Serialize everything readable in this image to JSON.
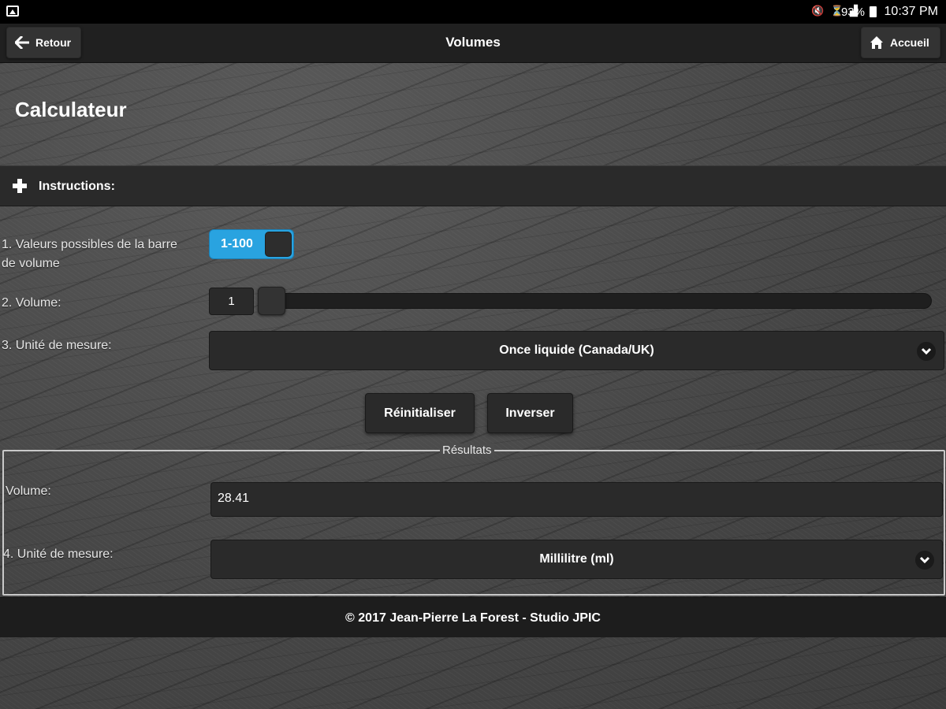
{
  "status_bar": {
    "battery": "93%",
    "time": "10:37 PM"
  },
  "header": {
    "back_label": "Retour",
    "title": "Volumes",
    "home_label": "Accueil"
  },
  "page": {
    "title": "Calculateur"
  },
  "instructions": {
    "label": "Instructions:"
  },
  "form": {
    "range_label": "1. Valeurs possibles de la barre de volume",
    "range_toggle_value": "1-100",
    "volume_label": "2. Volume:",
    "volume_value": "1",
    "volume_slider": {
      "min": 1,
      "max": 100,
      "value": 1
    },
    "unit_label": "3. Unité de mesure:",
    "unit_selected": "Once liquide (Canada/UK)",
    "reset_label": "Réinitialiser",
    "invert_label": "Inverser"
  },
  "results": {
    "legend": "Résultats",
    "volume_label": "Volume:",
    "volume_value": "28.41",
    "unit_label": "4. Unité de mesure:",
    "unit_selected": "Millilitre (ml)"
  },
  "footer": {
    "text": "© 2017 Jean-Pierre La Forest - Studio JPIC"
  },
  "colors": {
    "toggle_accent": "#29a3e0",
    "bar_background": "#202020",
    "control_background": "#2a2a2a"
  }
}
